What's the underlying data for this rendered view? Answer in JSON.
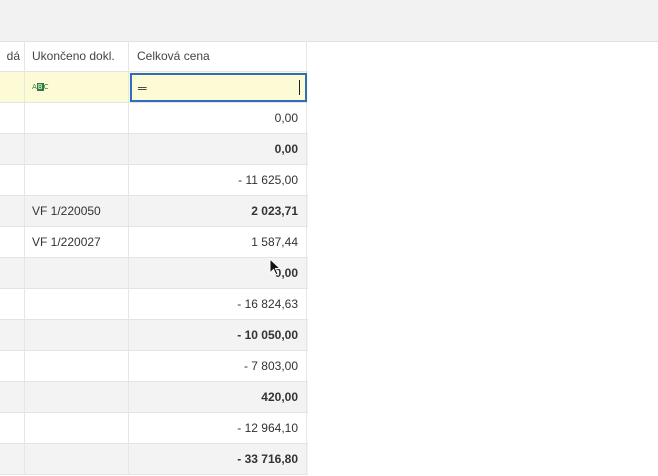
{
  "grid": {
    "headers": {
      "c0": "dá",
      "c1": "Ukončeno dokl.",
      "c2": "Celková cena"
    },
    "filter": {
      "c1_icon": "abc-filter-icon",
      "c2_icon": "equals-filter-icon",
      "c2_value": ""
    },
    "rows": [
      {
        "doc": "",
        "price": "0,00",
        "bold": false
      },
      {
        "doc": "",
        "price": "0,00",
        "bold": true
      },
      {
        "doc": "",
        "price": "-  11 625,00",
        "bold": false
      },
      {
        "doc": "VF 1/220050",
        "price": "2 023,71",
        "bold": true
      },
      {
        "doc": "VF 1/220027",
        "price": "1 587,44",
        "bold": false
      },
      {
        "doc": "",
        "price": "0,00",
        "bold": true
      },
      {
        "doc": "",
        "price": "-  16 824,63",
        "bold": false
      },
      {
        "doc": "",
        "price": "-  10 050,00",
        "bold": true
      },
      {
        "doc": "",
        "price": "-  7 803,00",
        "bold": false
      },
      {
        "doc": "",
        "price": "420,00",
        "bold": true
      },
      {
        "doc": "",
        "price": "-  12 964,10",
        "bold": false
      },
      {
        "doc": "",
        "price": "-  33 716,80",
        "bold": true
      }
    ]
  },
  "colors": {
    "filter_bg": "#fdfad6",
    "focus_border": "#2d6fbf",
    "alt_row": "#f3f3f3"
  }
}
